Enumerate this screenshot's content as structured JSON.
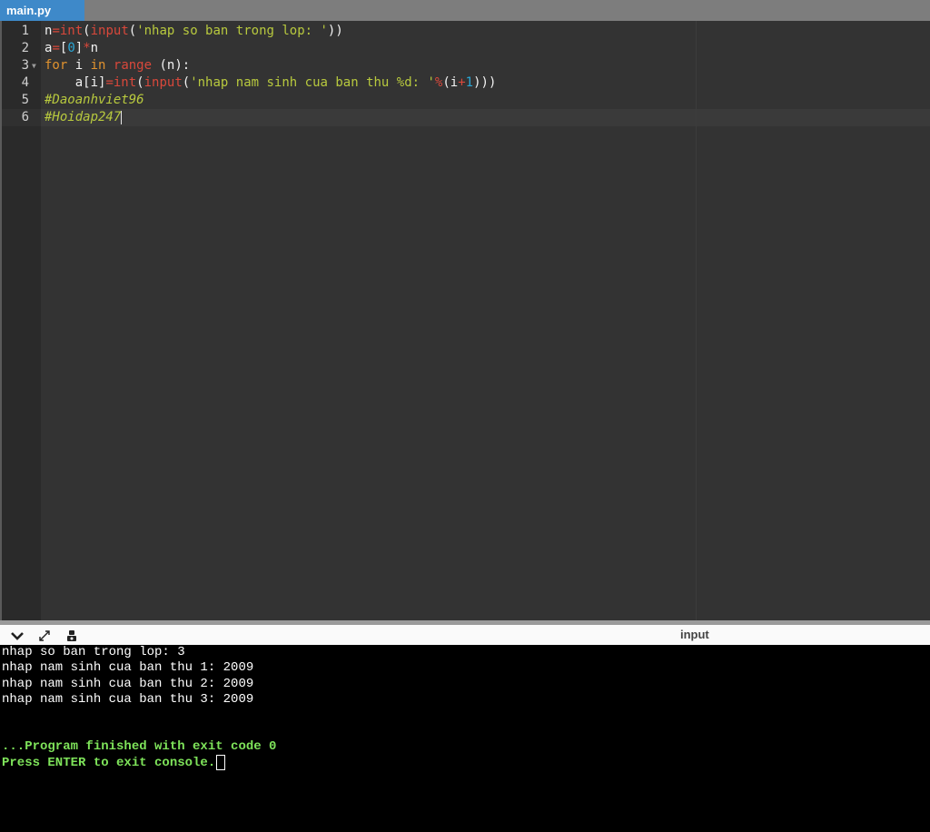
{
  "tab": {
    "filename": "main.py"
  },
  "editor": {
    "line_numbers": [
      "1",
      "2",
      "3",
      "4",
      "5",
      "6"
    ],
    "lines": [
      [
        {
          "t": "n",
          "c": "pl"
        },
        {
          "t": "=",
          "c": "op"
        },
        {
          "t": "int",
          "c": "bi"
        },
        {
          "t": "(",
          "c": "pl"
        },
        {
          "t": "input",
          "c": "bi"
        },
        {
          "t": "(",
          "c": "pl"
        },
        {
          "t": "'nhap so ban trong lop: '",
          "c": "st"
        },
        {
          "t": "))",
          "c": "pl"
        }
      ],
      [
        {
          "t": "a",
          "c": "pl"
        },
        {
          "t": "=",
          "c": "op"
        },
        {
          "t": "[",
          "c": "pl"
        },
        {
          "t": "0",
          "c": "nm"
        },
        {
          "t": "]",
          "c": "pl"
        },
        {
          "t": "*",
          "c": "op"
        },
        {
          "t": "n",
          "c": "pl"
        }
      ],
      [
        {
          "t": "for",
          "c": "kw"
        },
        {
          "t": " i ",
          "c": "pl"
        },
        {
          "t": "in",
          "c": "kw"
        },
        {
          "t": " ",
          "c": "pl"
        },
        {
          "t": "range",
          "c": "bi"
        },
        {
          "t": " (n):",
          "c": "pl"
        }
      ],
      [
        {
          "t": "    a[i]",
          "c": "pl"
        },
        {
          "t": "=",
          "c": "op"
        },
        {
          "t": "int",
          "c": "bi"
        },
        {
          "t": "(",
          "c": "pl"
        },
        {
          "t": "input",
          "c": "bi"
        },
        {
          "t": "(",
          "c": "pl"
        },
        {
          "t": "'nhap nam sinh cua ban thu %d: '",
          "c": "st"
        },
        {
          "t": "%",
          "c": "op"
        },
        {
          "t": "(i",
          "c": "pl"
        },
        {
          "t": "+",
          "c": "op"
        },
        {
          "t": "1",
          "c": "nm"
        },
        {
          "t": ")))",
          "c": "pl"
        }
      ],
      [
        {
          "t": "#Daoanhviet96",
          "c": "cm"
        }
      ],
      [
        {
          "t": "#Hoidap247",
          "c": "cm"
        }
      ]
    ]
  },
  "console_bar": {
    "input_label": "input",
    "icons": [
      "chevron-down-icon",
      "expand-icon",
      "settings-icon"
    ]
  },
  "console": {
    "output": [
      "nhap so ban trong lop: 3",
      "nhap nam sinh cua ban thu 1: 2009",
      "nhap nam sinh cua ban thu 2: 2009",
      "nhap nam sinh cua ban thu 3: 2009"
    ],
    "finished": "...Program finished with exit code 0",
    "press_enter": "Press ENTER to exit console."
  },
  "colors": {
    "tab_bg": "#3e89c9",
    "keyword": "#e0922e",
    "builtin": "#d9483b",
    "string": "#b8c93e",
    "number": "#2aa7d6",
    "console_green": "#7ee35a"
  }
}
